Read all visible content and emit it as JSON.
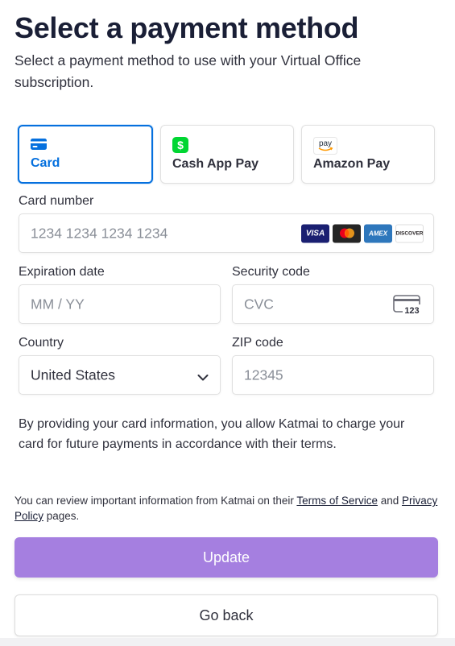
{
  "header": {
    "title": "Select a payment method",
    "subtitle": "Select a payment method to use with your Virtual Office subscription."
  },
  "payment_methods": [
    {
      "label": "Card",
      "icon": "card-icon",
      "selected": true
    },
    {
      "label": "Cash App Pay",
      "icon": "cash-app-icon",
      "selected": false
    },
    {
      "label": "Amazon Pay",
      "icon": "amazon-pay-icon",
      "icon_text": "pay",
      "selected": false
    }
  ],
  "form": {
    "card_number": {
      "label": "Card number",
      "placeholder": "1234 1234 1234 1234"
    },
    "card_brands": [
      "VISA",
      "Mastercard",
      "AMEX",
      "DISCOVER"
    ],
    "expiration": {
      "label": "Expiration date",
      "placeholder": "MM / YY"
    },
    "security": {
      "label": "Security code",
      "placeholder": "CVC",
      "icon_text": "123"
    },
    "country": {
      "label": "Country",
      "value": "United States"
    },
    "zip": {
      "label": "ZIP code",
      "placeholder": "12345"
    }
  },
  "notice": "By providing your card information, you allow Katmai to charge your card for future payments in accordance with their terms.",
  "terms": {
    "prefix": "You can review important information from Katmai on their ",
    "tos_link": "Terms of Service",
    "middle": " and ",
    "privacy_link": "Privacy Policy",
    "suffix": " pages."
  },
  "buttons": {
    "update": "Update",
    "back": "Go back"
  },
  "colors": {
    "accent": "#0570de",
    "update_button": "#a57fe0",
    "cash_app": "#00d632",
    "amazon": "#ff9900"
  }
}
